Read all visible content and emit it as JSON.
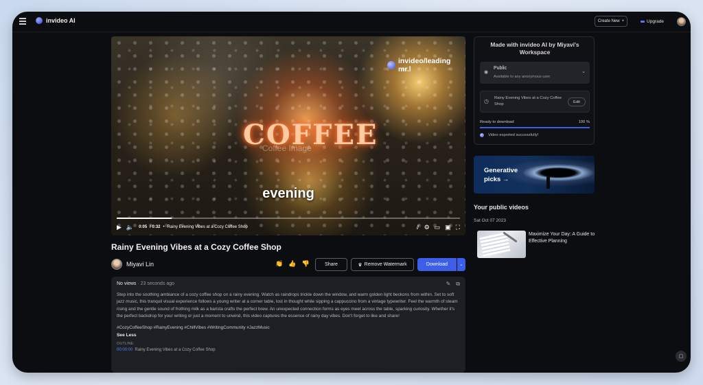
{
  "topbar": {
    "app_name": "invideo AI",
    "create_new_label": "Create New",
    "create_new_icon": "+",
    "upgrade_label": "Upgrade"
  },
  "video": {
    "neon_text": "COFFEE",
    "watermark_faint": "Coffee Image",
    "watermark_tag": "invideo/leading mr.l",
    "caption": "evening",
    "progress": 0.16,
    "time_current": "0:05",
    "time_total": "/ 0:32",
    "time_sep": "•",
    "controls_title": "Rainy Evening Vibes at a Cozy Coffee Shop"
  },
  "main": {
    "title": "Rainy Evening Vibes at a Cozy Coffee Shop",
    "author": "Miyavi Lin",
    "share_label": "Share",
    "remove_watermark_label": "Remove Watermark",
    "download_label": "Download"
  },
  "description": {
    "views": "No views",
    "sep": " · ",
    "time_ago": "23 seconds ago",
    "body": "Step into the soothing ambiance of a cozy coffee shop on a rainy evening. Watch as raindrops trickle down the window, and warm golden light beckons from within. Set to soft jazz music, this tranquil visual experience follows a young writer at a corner table, lost in thought while sipping a cappuccino from a vintage typewriter. Feel the warmth of steam rising and the gentle sound of frothing milk as a barista crafts the perfect brew. An unexpected connection forms as eyes meet across the table, sparking curiosity. Whether it's the perfect backdrop for your writing or just a moment to unwind, this video captures the essence of rainy day vibes. Don't forget to like and share!",
    "hashtags": "#CozyCoffeeShop #RainyEvening #ChillVibes #WritingCommunity #JazzMusic",
    "see_less": "See Less",
    "outline_label": "OUTLINE:",
    "outline_items": [
      {
        "time": "00:00:00",
        "title": "Rainy Evening Vibes at a Cozy Coffee Shop"
      }
    ]
  },
  "sidebar": {
    "made_with": "Made with invideo AI by Miyavi's Workspace",
    "visibility_title": "Public",
    "visibility_sub": "Available to any anonymous user",
    "video_name": "Rainy Evening Vibes at a Cozy Coffee Shop",
    "edit_label": "Edit",
    "ready_label": "Ready to download",
    "ready_percent": "100 %",
    "export_msg": "Video exported successfully!",
    "banner_text": "Generative picks →",
    "public_videos_title": "Your public videos",
    "public_date": "Sat Oct 07 2023",
    "public_video_title": "Maximize Your Day: A Guide to Effective Planning"
  },
  "colors": {
    "accent": "#3c5ee8",
    "background": "#0c0d10",
    "panel": "#1d1f24",
    "annotation_arrow": "#e53935"
  }
}
